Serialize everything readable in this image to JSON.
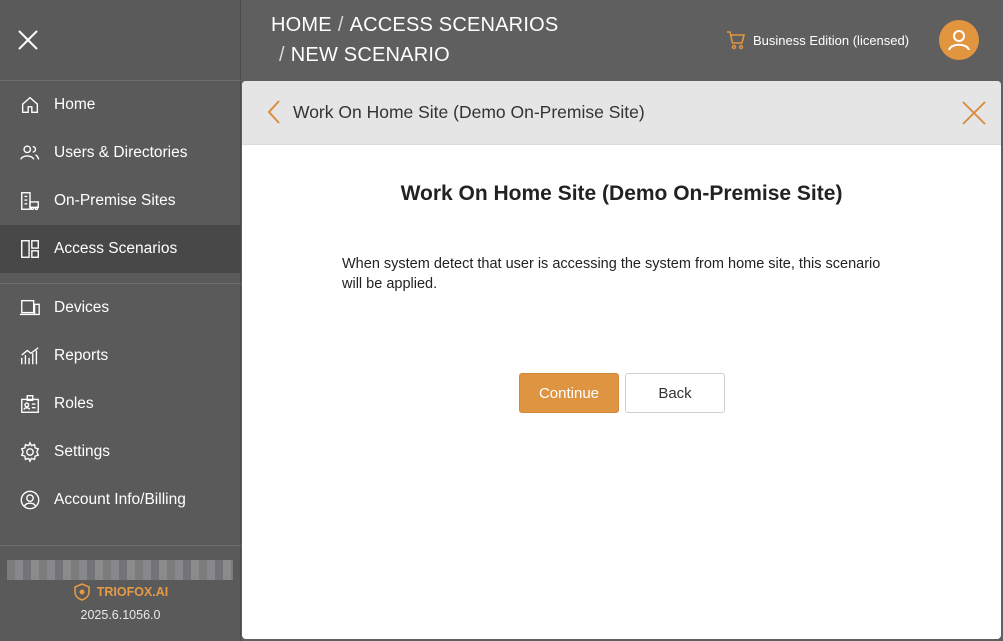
{
  "breadcrumb": {
    "home": "HOME",
    "separator": "/",
    "section": "ACCESS SCENARIOS",
    "current": "NEW SCENARIO"
  },
  "edition": {
    "label": "Business Edition (licensed)"
  },
  "sidebar": {
    "items": [
      {
        "label": "Home",
        "icon": "home-icon"
      },
      {
        "label": "Users & Directories",
        "icon": "users-icon"
      },
      {
        "label": "On-Premise Sites",
        "icon": "building-icon"
      },
      {
        "label": "Access Scenarios",
        "icon": "layout-icon",
        "active": true
      },
      {
        "label": "Devices",
        "icon": "devices-icon"
      },
      {
        "label": "Reports",
        "icon": "chart-icon"
      },
      {
        "label": "Roles",
        "icon": "badge-icon"
      },
      {
        "label": "Settings",
        "icon": "gear-icon"
      },
      {
        "label": "Account Info/Billing",
        "icon": "account-icon"
      }
    ],
    "brand": "TRIOFOX.AI",
    "version": "2025.6.1056.0"
  },
  "panel": {
    "header_title": "Work On Home Site (Demo On-Premise Site)",
    "title": "Work On Home Site (Demo On-Premise Site)",
    "description": "When system detect that user is accessing the system from home site, this scenario will be applied.",
    "continue_label": "Continue",
    "back_label": "Back"
  },
  "colors": {
    "accent": "#de9440",
    "sidebar_bg": "#5a5a5a",
    "active_bg": "#484848"
  }
}
